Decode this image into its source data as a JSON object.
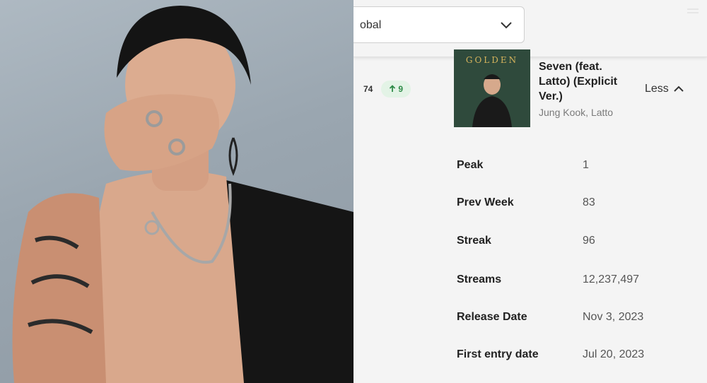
{
  "header": {
    "region_value": "obal"
  },
  "track": {
    "rank": "74",
    "rank_change": "9",
    "cover_text": "GOLDEN",
    "title": "Seven (feat. Latto) (Explicit Ver.)",
    "artists": "Jung Kook, Latto",
    "toggle_label": "Less"
  },
  "stats": [
    {
      "label": "Peak",
      "value": "1"
    },
    {
      "label": "Prev Week",
      "value": "83"
    },
    {
      "label": "Streak",
      "value": "96"
    },
    {
      "label": "Streams",
      "value": "12,237,497"
    },
    {
      "label": "Release Date",
      "value": "Nov 3, 2023"
    },
    {
      "label": "First entry date",
      "value": "Jul 20, 2023"
    }
  ],
  "icons": {
    "dropdown": "chevron-down-icon",
    "change": "arrow-up-icon",
    "toggle": "chevron-up-icon"
  },
  "colors": {
    "delta_bg": "#e3f3e6",
    "delta_text": "#2e8b48"
  }
}
